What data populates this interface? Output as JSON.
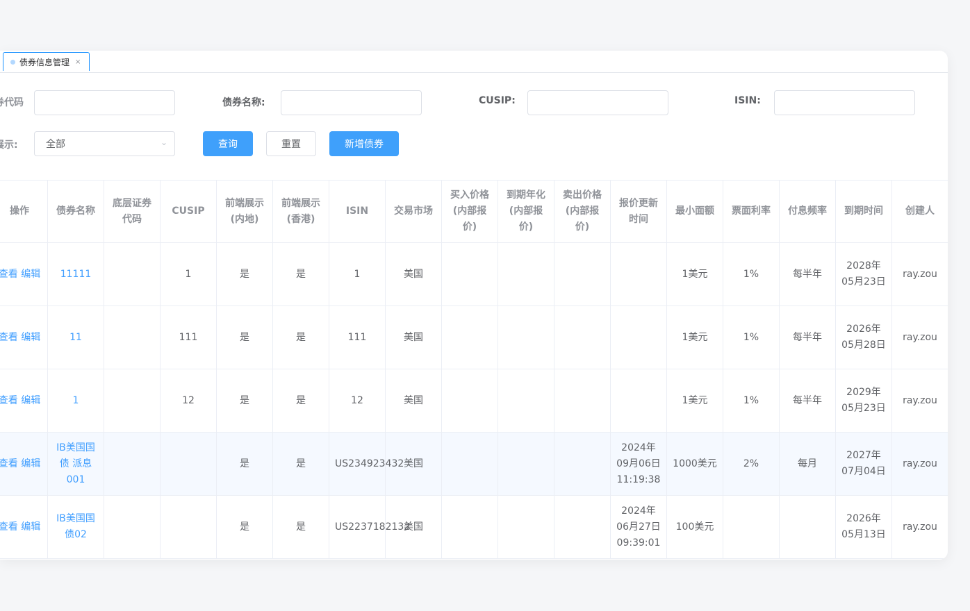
{
  "tab": {
    "label": "债券信息管理",
    "close": "×"
  },
  "filters": {
    "code_label": "券代码",
    "name_label": "债券名称:",
    "cusip_label": "CUSIP:",
    "isin_label": "ISIN:",
    "display_label": "展示:",
    "display_value": "全部",
    "query_btn": "查询",
    "reset_btn": "重置",
    "add_btn": "新增债券"
  },
  "columns": [
    "操作",
    "债券名称",
    "底层证券代码",
    "CUSIP",
    "前端展示(内地)",
    "前端展示(香港)",
    "ISIN",
    "交易市场",
    "买入价格(内部报价)",
    "到期年化(内部报价)",
    "卖出价格(内部报价)",
    "报价更新时间",
    "最小面额",
    "票面利率",
    "付息频率",
    "到期时间",
    "创建人"
  ],
  "rows": [
    {
      "ops": "查看 编辑",
      "name": "11111",
      "underlying": "",
      "cusip": "1",
      "mainland": "是",
      "hk": "是",
      "isin": "1",
      "market": "美国",
      "buy": "",
      "yield": "",
      "sell": "",
      "updated": "",
      "min_denom": "1美元",
      "coupon": "1%",
      "freq": "每半年",
      "maturity": "2028年05月23日",
      "creator": "ray.zou"
    },
    {
      "ops": "查看 编辑",
      "name": "11",
      "underlying": "",
      "cusip": "111",
      "mainland": "是",
      "hk": "是",
      "isin": "111",
      "market": "美国",
      "buy": "",
      "yield": "",
      "sell": "",
      "updated": "",
      "min_denom": "1美元",
      "coupon": "1%",
      "freq": "每半年",
      "maturity": "2026年05月28日",
      "creator": "ray.zou"
    },
    {
      "ops": "查看 编辑",
      "name": "1",
      "underlying": "",
      "cusip": "12",
      "mainland": "是",
      "hk": "是",
      "isin": "12",
      "market": "美国",
      "buy": "",
      "yield": "",
      "sell": "",
      "updated": "",
      "min_denom": "1美元",
      "coupon": "1%",
      "freq": "每半年",
      "maturity": "2029年05月23日",
      "creator": "ray.zou"
    },
    {
      "ops": "查看 编辑",
      "name": "IB美国国债 派息 001",
      "underlying": "",
      "cusip": "",
      "mainland": "是",
      "hk": "是",
      "isin": "US234923432",
      "market": "美国",
      "buy": "",
      "yield": "",
      "sell": "",
      "updated": "2024年09月06日 11:19:38",
      "min_denom": "1000美元",
      "coupon": "2%",
      "freq": "每月",
      "maturity": "2027年07月04日",
      "creator": "ray.zou"
    },
    {
      "ops": "查看 编辑",
      "name": "IB美国国债02",
      "underlying": "",
      "cusip": "",
      "mainland": "是",
      "hk": "是",
      "isin": "US2237182132",
      "market": "美国",
      "buy": "",
      "yield": "",
      "sell": "",
      "updated": "2024年06月27日 09:39:01",
      "min_denom": "100美元",
      "coupon": "",
      "freq": "",
      "maturity": "2026年05月13日",
      "creator": "ray.zou"
    }
  ],
  "colors": {
    "primary": "#3fa0fb",
    "link": "#409eff",
    "border": "#ebeef5"
  }
}
